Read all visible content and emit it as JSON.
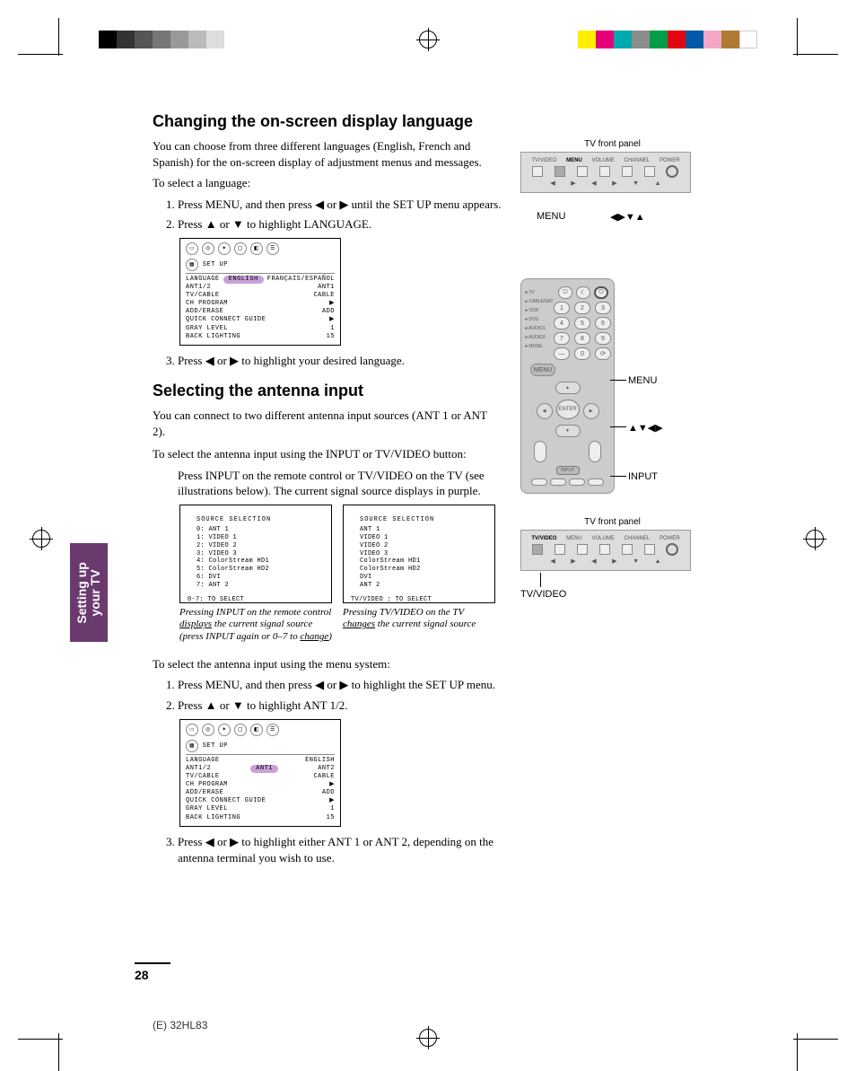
{
  "section1": {
    "heading": "Changing the on-screen display language",
    "intro": "You can choose from three different languages (English, French and Spanish) for the on-screen display of adjustment menus and messages.",
    "lead": "To select a language:",
    "step1": "Press MENU, and then press ◀ or ▶ until the SET UP menu appears.",
    "step2": "Press ▲ or ▼ to highlight LANGUAGE.",
    "step3": "Press ◀ or ▶ to highlight your desired language."
  },
  "section2": {
    "heading": "Selecting the antenna input",
    "intro": "You can connect to two different antenna input sources (ANT 1 or ANT 2).",
    "lead1": "To select the antenna input using the INPUT or TV/VIDEO button:",
    "body1": "Press INPUT on the remote control or TV/VIDEO on the TV (see illustrations below). The current signal source displays in purple.",
    "lead2": "To select the antenna input using the menu system:",
    "step1": "Press MENU, and then press ◀ or ▶ to highlight the SET UP menu.",
    "step2": "Press ▲ or ▼ to highlight ANT 1/2.",
    "step3": "Press ◀ or ▶ to highlight either ANT 1 or ANT 2, depending on the antenna terminal you wish to use."
  },
  "osd1": {
    "title": "SET UP",
    "rows": [
      [
        "LANGUAGE",
        "ENGLISH",
        "FRANÇAIS/ESPAÑOL"
      ],
      [
        "ANT1/2",
        "ANT1"
      ],
      [
        "TV/CABLE",
        "CABLE"
      ],
      [
        "CH PROGRAM",
        "▶"
      ],
      [
        "ADD/ERASE",
        "ADD"
      ],
      [
        "QUICK CONNECT GUIDE",
        "▶"
      ],
      [
        "GRAY LEVEL",
        "1"
      ],
      [
        "BACK LIGHTING",
        "15"
      ]
    ]
  },
  "osd2": {
    "title": "SET UP",
    "rows": [
      [
        "LANGUAGE",
        "ENGLISH"
      ],
      [
        "ANT1/2",
        "ANT1",
        "ANT2"
      ],
      [
        "TV/CABLE",
        "CABLE"
      ],
      [
        "CH PROGRAM",
        "▶"
      ],
      [
        "ADD/ERASE",
        "ADD"
      ],
      [
        "QUICK CONNECT GUIDE",
        "▶"
      ],
      [
        "GRAY LEVEL",
        "1"
      ],
      [
        "BACK LIGHTING",
        "15"
      ]
    ]
  },
  "src1": {
    "title": "SOURCE SELECTION",
    "lines": [
      "0: ANT 1",
      "1: VIDEO 1",
      "2: VIDEO 2",
      "3: VIDEO 3",
      "4: ColorStream HD1",
      "5: ColorStream HD2",
      "6: DVI",
      "7: ANT 2"
    ],
    "footer": "0-7: TO SELECT"
  },
  "src2": {
    "title": "SOURCE SELECTION",
    "lines": [
      "ANT 1",
      "VIDEO 1",
      "VIDEO 2",
      "VIDEO 3",
      "ColorStream HD1",
      "ColorStream HD2",
      "DVI",
      "ANT 2"
    ],
    "footer": "TV/VIDEO : TO SELECT"
  },
  "caption1a": "Pressing INPUT on the remote control ",
  "caption1b": "displays",
  "caption1c": " the current signal source (press INPUT again or 0–7 to ",
  "caption1d": "change",
  "caption1e": ")",
  "caption2a": "Pressing TV/VIDEO on the TV ",
  "caption2b": "changes",
  "caption2c": " the current signal source",
  "tvpanel": {
    "label": "TV front panel",
    "labels": [
      "TV/VIDEO",
      "MENU",
      "VOLUME",
      "CHANNEL",
      "POWER"
    ],
    "menu_caption": "MENU",
    "arrows_caption": "◀▶▼▲",
    "tvvideo_caption": "TV/VIDEO"
  },
  "remote": {
    "menu_caption": "MENU",
    "arrows_caption": "▲▼◀▶",
    "input_caption": "INPUT",
    "side_labels": [
      "TV",
      "CABLE/SAT",
      "VCR",
      "DVD",
      "AUDIO1",
      "AUDIO2",
      "MODE"
    ],
    "enter": "ENTER",
    "menu": "MENU",
    "input": "INPUT"
  },
  "side_tab": "Setting up\nyour TV",
  "page_number": "28",
  "footer_model": "(E) 32HL83",
  "colorbar_left": [
    "#000",
    "#333",
    "#555",
    "#777",
    "#999",
    "#bbb",
    "#ddd",
    "#fff"
  ],
  "colorbar_right": [
    "#ffee00",
    "#e5007a",
    "#00a8b0",
    "#8c8c8c",
    "#009e49",
    "#e30613",
    "#0058a8",
    "#f4a6c8",
    "#b07a35",
    "#fff"
  ]
}
